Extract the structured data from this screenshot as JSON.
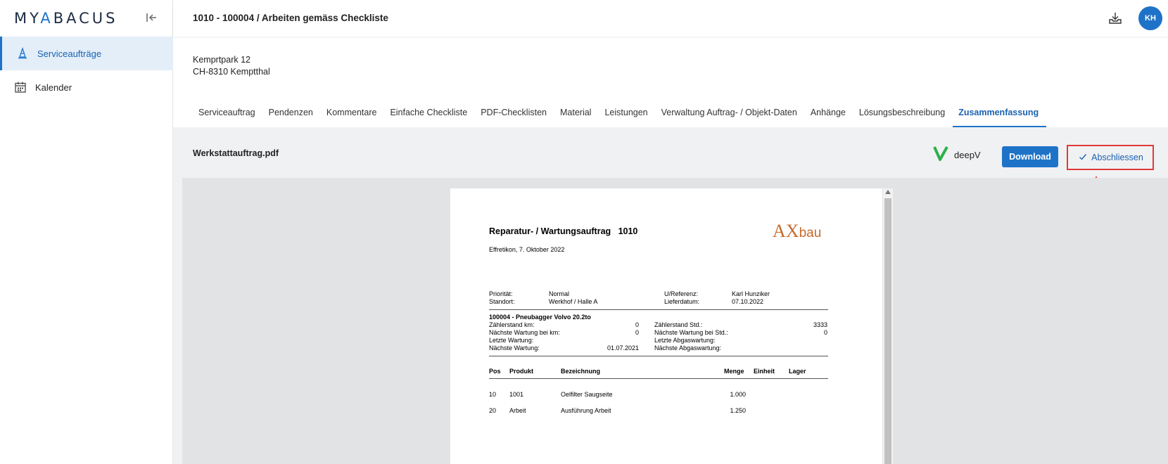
{
  "sidebar": {
    "logo": {
      "part1": "MY",
      "accent": "A",
      "part2": "BACUS"
    },
    "items": [
      {
        "label": "Serviceaufträge",
        "icon": "traffic-cone-icon",
        "active": true
      },
      {
        "label": "Kalender",
        "icon": "calendar-icon",
        "active": false
      }
    ]
  },
  "header": {
    "title": "1010 - 100004 / Arbeiten gemäss Checkliste",
    "avatar": "KH"
  },
  "address": {
    "line1": "Kemprtpark 12",
    "line2": "CH-8310 Kemptthal"
  },
  "tabs": [
    {
      "label": "Serviceauftrag"
    },
    {
      "label": "Pendenzen"
    },
    {
      "label": "Kommentare"
    },
    {
      "label": "Einfache Checkliste"
    },
    {
      "label": "PDF-Checklisten"
    },
    {
      "label": "Material"
    },
    {
      "label": "Leistungen"
    },
    {
      "label": "Verwaltung Auftrag- / Objekt-Daten"
    },
    {
      "label": "Anhänge"
    },
    {
      "label": "Lösungsbeschreibung"
    },
    {
      "label": "Zusammenfassung",
      "active": true
    }
  ],
  "content": {
    "filename": "Werkstattauftrag.pdf",
    "deepv_label": "deepV",
    "download_label": "Download",
    "close_label": "Abschliessen"
  },
  "colors": {
    "accent": "#1e73c8",
    "highlight": "#e0393b",
    "logo_brand": "#c56a2c",
    "deepv_green": "#2bb14a"
  },
  "pdf": {
    "title": "Reparatur- / Wartungsauftrag   1010",
    "date": "Effretikon, 7. Oktober 2022",
    "logo": {
      "ax": "AX",
      "bau": "bau"
    },
    "meta": {
      "prioritaet_label": "Priorität:",
      "prioritaet": "Normal",
      "standort_label": "Standort:",
      "standort": "Werkhof / Halle A",
      "referenz_label": "U/Referenz:",
      "referenz": "Karl Hunziker",
      "lieferdatum_label": "Lieferdatum:",
      "lieferdatum": "07.10.2022"
    },
    "object": {
      "title": "100004 - Pneubagger Volvo 20.2to",
      "left": [
        {
          "label": "Zählerstand km:",
          "value": "0"
        },
        {
          "label": "Nächste Wartung bei km:",
          "value": "0"
        },
        {
          "label": "Letzte Wartung:",
          "value": ""
        },
        {
          "label": "Nächste Wartung:",
          "value": "01.07.2021"
        }
      ],
      "right": [
        {
          "label": "Zählerstand Std.:",
          "value": "3333"
        },
        {
          "label": "Nächste Wartung bei Std.:",
          "value": "0"
        },
        {
          "label": "Letzte Abgaswartung:",
          "value": ""
        },
        {
          "label": "Nächste Abgaswartung:",
          "value": ""
        }
      ]
    },
    "table": {
      "headers": {
        "pos": "Pos",
        "produkt": "Produkt",
        "bezeichnung": "Bezeichnung",
        "menge": "Menge",
        "einheit": "Einheit",
        "lager": "Lager"
      },
      "rows": [
        {
          "pos": "10",
          "produkt": "1001",
          "bezeichnung": "Oelfilter Saugseite",
          "menge": "1.000"
        },
        {
          "pos": "20",
          "produkt": "Arbeit",
          "bezeichnung": "Ausführung Arbeit",
          "menge": "1.250"
        }
      ]
    }
  }
}
